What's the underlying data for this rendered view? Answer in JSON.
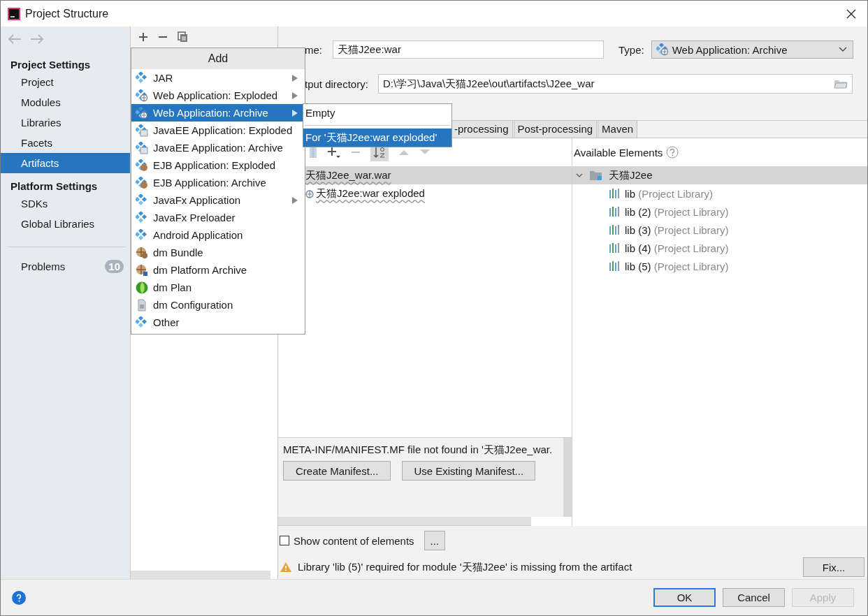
{
  "window": {
    "title": "Project Structure"
  },
  "sidebar": {
    "sections": [
      {
        "heading": "Project Settings",
        "items": [
          {
            "label": "Project",
            "selected": false
          },
          {
            "label": "Modules",
            "selected": false
          },
          {
            "label": "Libraries",
            "selected": false
          },
          {
            "label": "Facets",
            "selected": false
          },
          {
            "label": "Artifacts",
            "selected": true
          }
        ]
      },
      {
        "heading": "Platform Settings",
        "items": [
          {
            "label": "SDKs",
            "selected": false
          },
          {
            "label": "Global Libraries",
            "selected": false
          }
        ]
      }
    ],
    "problems": {
      "label": "Problems",
      "count": "10"
    }
  },
  "add_menu": {
    "title": "Add",
    "items": [
      {
        "label": "JAR",
        "kind": "module",
        "submenu": true,
        "selected": false
      },
      {
        "label": "Web Application: Exploded",
        "kind": "web",
        "submenu": true,
        "selected": false
      },
      {
        "label": "Web Application: Archive",
        "kind": "web",
        "submenu": true,
        "selected": true
      },
      {
        "label": "JavaEE Application: Exploded",
        "kind": "javaee",
        "submenu": false,
        "selected": false
      },
      {
        "label": "JavaEE Application: Archive",
        "kind": "javaee",
        "submenu": false,
        "selected": false
      },
      {
        "label": "EJB Application: Exploded",
        "kind": "ejb",
        "submenu": false,
        "selected": false
      },
      {
        "label": "EJB Application: Archive",
        "kind": "ejb",
        "submenu": false,
        "selected": false
      },
      {
        "label": "JavaFx Application",
        "kind": "module",
        "submenu": true,
        "selected": false
      },
      {
        "label": "JavaFx Preloader",
        "kind": "module",
        "submenu": false,
        "selected": false
      },
      {
        "label": "Android Application",
        "kind": "module",
        "submenu": false,
        "selected": false
      },
      {
        "label": "dm Bundle",
        "kind": "bundle",
        "submenu": false,
        "selected": false
      },
      {
        "label": "dm Platform Archive",
        "kind": "platform",
        "submenu": false,
        "selected": false
      },
      {
        "label": "dm Plan",
        "kind": "plan",
        "submenu": false,
        "selected": false
      },
      {
        "label": "dm Configuration",
        "kind": "config",
        "submenu": false,
        "selected": false
      },
      {
        "label": "Other",
        "kind": "module",
        "submenu": false,
        "selected": false
      }
    ],
    "submenu": [
      {
        "label": "Empty",
        "selected": false
      },
      {
        "label": "For '天猫J2ee:war exploded'",
        "selected": true
      }
    ]
  },
  "editor": {
    "name": {
      "label": "me:",
      "value": "天猫J2ee:war"
    },
    "type": {
      "label": "Type:",
      "value": "Web Application: Archive"
    },
    "output_directory": {
      "label": "tput directory:",
      "value": "D:\\学习\\Java\\天猫J2ee\\out\\artifacts\\J2ee_war"
    },
    "tabs": [
      {
        "label": "-processing",
        "selected": false
      },
      {
        "label": "Post-processing",
        "selected": false
      },
      {
        "label": "Maven",
        "selected": false
      }
    ],
    "layout_tree": [
      {
        "label": "天猫J2ee_war.war",
        "selected": true,
        "children": [
          {
            "label": "天猫J2ee:war exploded",
            "selected": false
          }
        ]
      }
    ],
    "available_elements": {
      "title": "Available Elements",
      "tree": [
        {
          "label": "天猫J2ee",
          "expanded": true,
          "selected": true,
          "children": [
            {
              "label": "lib",
              "note": "(Project Library)"
            },
            {
              "label": "lib (2)",
              "note": "(Project Library)"
            },
            {
              "label": "lib (3)",
              "note": "(Project Library)"
            },
            {
              "label": "lib (4)",
              "note": "(Project Library)"
            },
            {
              "label": "lib (5)",
              "note": "(Project Library)"
            }
          ]
        }
      ]
    },
    "manifest": {
      "message": "META-INF/MANIFEST.MF file not found in '天猫J2ee_war.",
      "buttons": [
        "Create Manifest...",
        "Use Existing Manifest..."
      ]
    },
    "show_content": {
      "label": "Show content of elements",
      "checked": false,
      "button": "..."
    },
    "warning": {
      "message": "Library 'lib (5)' required for module '天猫J2ee' is missing from the artifact",
      "button": "Fix..."
    }
  },
  "footer": {
    "buttons": [
      {
        "label": "OK",
        "kind": "default",
        "disabled": false
      },
      {
        "label": "Cancel",
        "kind": "normal",
        "disabled": false
      },
      {
        "label": "Apply",
        "kind": "normal",
        "disabled": true
      }
    ]
  }
}
